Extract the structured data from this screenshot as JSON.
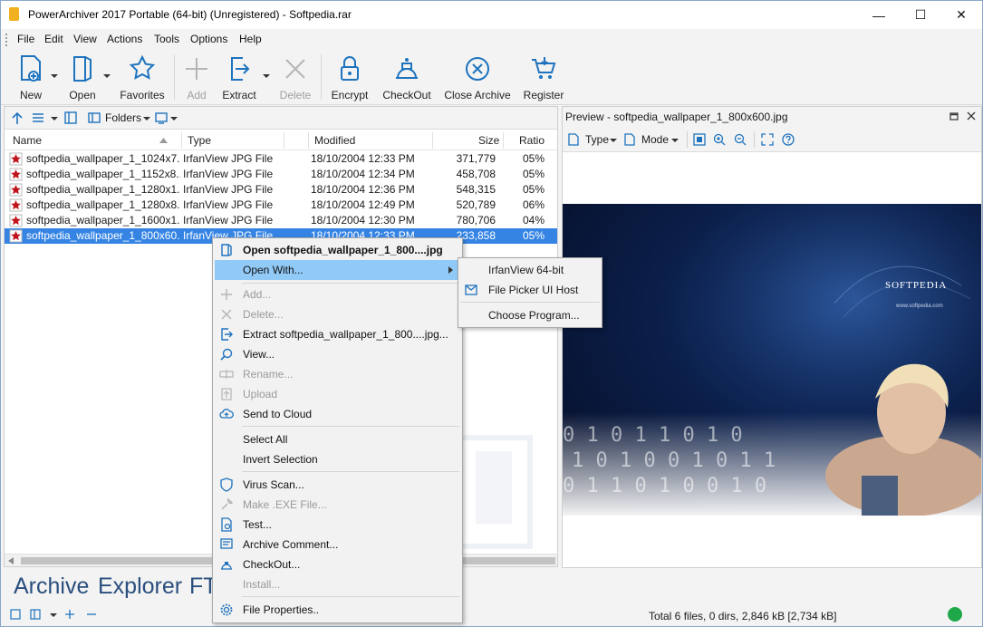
{
  "window": {
    "title": "PowerArchiver 2017 Portable (64-bit) (Unregistered) - Softpedia.rar",
    "minimize_glyph": "—",
    "maximize_glyph": "☐",
    "close_glyph": "✕"
  },
  "menu": [
    "File",
    "Edit",
    "View",
    "Actions",
    "Tools",
    "Options",
    "Help"
  ],
  "toolbar": {
    "new": "New",
    "open": "Open",
    "favorites": "Favorites",
    "add": "Add",
    "extract": "Extract",
    "delete": "Delete",
    "encrypt": "Encrypt",
    "checkout": "CheckOut",
    "close_archive": "Close Archive",
    "register": "Register"
  },
  "pane_toolbar": {
    "folders": "Folders"
  },
  "columns": {
    "name": "Name",
    "type": "Type",
    "modified": "Modified",
    "size": "Size",
    "ratio": "Ratio"
  },
  "files": [
    {
      "name": "softpedia_wallpaper_1_1024x7...",
      "type": "IrfanView JPG File",
      "modified": "18/10/2004 12:33 PM",
      "size": "371,779",
      "ratio": "05%"
    },
    {
      "name": "softpedia_wallpaper_1_1152x8...",
      "type": "IrfanView JPG File",
      "modified": "18/10/2004 12:34 PM",
      "size": "458,708",
      "ratio": "05%"
    },
    {
      "name": "softpedia_wallpaper_1_1280x1...",
      "type": "IrfanView JPG File",
      "modified": "18/10/2004 12:36 PM",
      "size": "548,315",
      "ratio": "05%"
    },
    {
      "name": "softpedia_wallpaper_1_1280x8...",
      "type": "IrfanView JPG File",
      "modified": "18/10/2004 12:49 PM",
      "size": "520,789",
      "ratio": "06%"
    },
    {
      "name": "softpedia_wallpaper_1_1600x1...",
      "type": "IrfanView JPG File",
      "modified": "18/10/2004 12:30 PM",
      "size": "780,706",
      "ratio": "04%"
    },
    {
      "name": "softpedia_wallpaper_1_800x60...",
      "type": "IrfanView JPG File",
      "modified": "18/10/2004 12:33 PM",
      "size": "233,858",
      "ratio": "05%"
    }
  ],
  "preview": {
    "title": "Preview - softpedia_wallpaper_1_800x600.jpg",
    "type_label": "Type",
    "mode_label": "Mode",
    "image_brand": "SOFTPEDIA",
    "image_url": "www.softpedia.com"
  },
  "context_menu": {
    "open": "Open softpedia_wallpaper_1_800....jpg",
    "open_with": "Open With...",
    "add": "Add...",
    "delete": "Delete...",
    "extract": "Extract softpedia_wallpaper_1_800....jpg...",
    "view": "View...",
    "rename": "Rename...",
    "upload": "Upload",
    "send_to_cloud": "Send to Cloud",
    "select_all": "Select All",
    "invert_selection": "Invert Selection",
    "virus_scan": "Virus Scan...",
    "make_exe": "Make .EXE File...",
    "test": "Test...",
    "archive_comment": "Archive Comment...",
    "checkout": "CheckOut...",
    "install": "Install...",
    "file_properties": "File Properties.."
  },
  "submenu": {
    "irfanview": "IrfanView 64-bit",
    "file_picker": "File Picker UI Host",
    "choose_program": "Choose Program..."
  },
  "bottom_tabs": [
    "Archive",
    "Explorer",
    "FT"
  ],
  "status": {
    "text": "Total 6 files, 0 dirs, 2,846 kB [2,734 kB]",
    "indicator_color": "#1fa84a"
  },
  "colors": {
    "accent": "#3584e4",
    "menu_highlight": "#91c9f7",
    "icon_blue": "#1e73be"
  }
}
